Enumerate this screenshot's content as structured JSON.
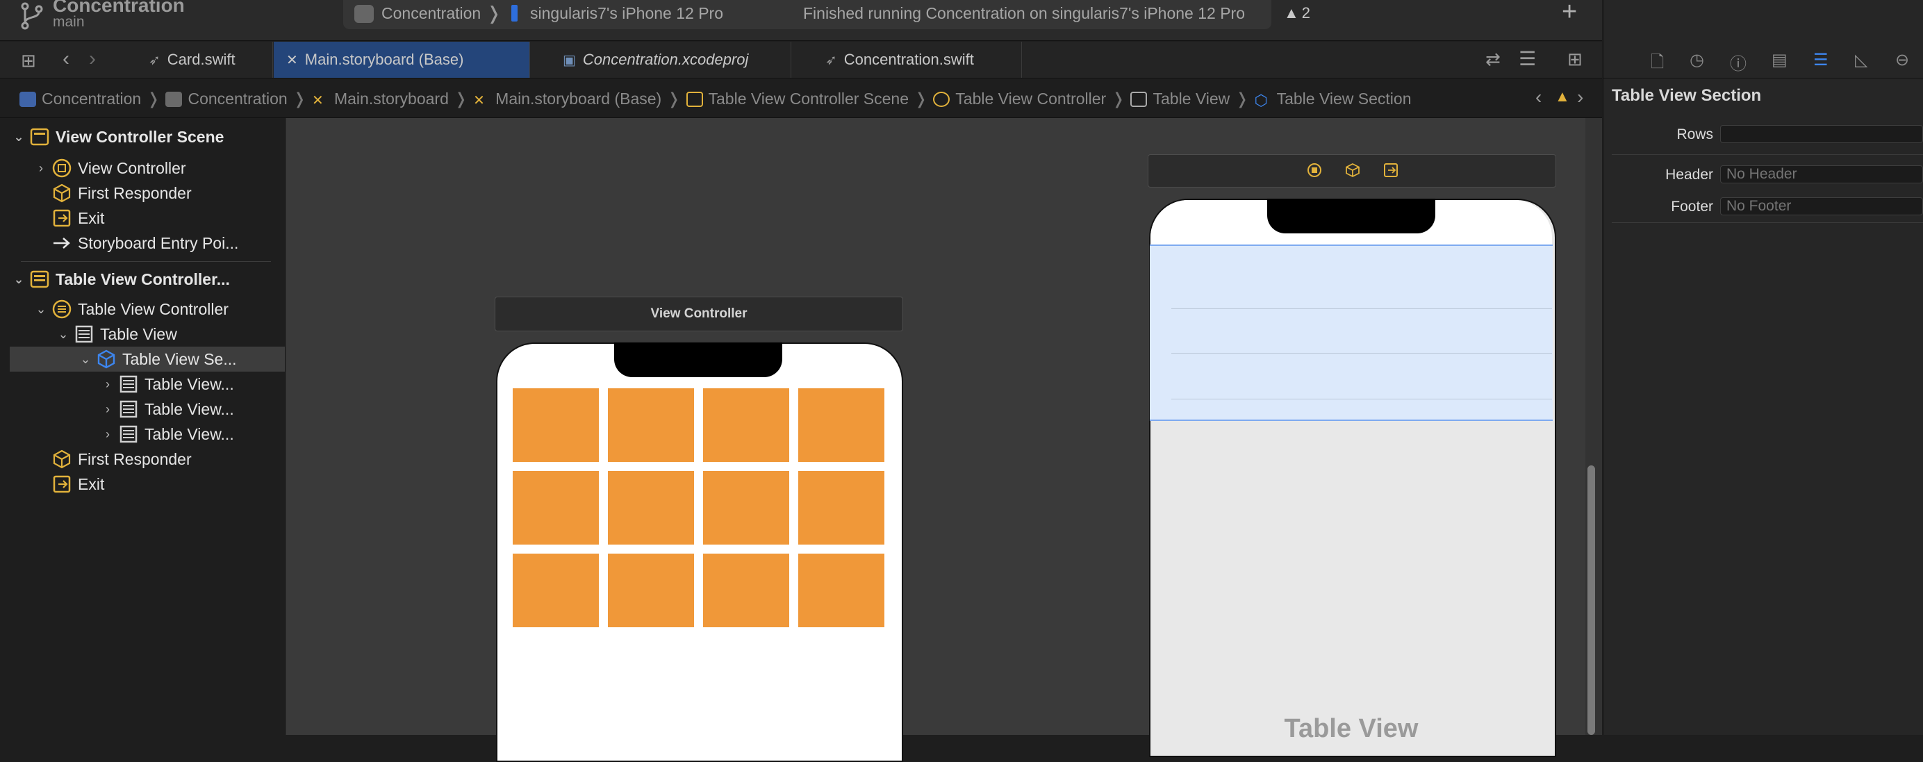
{
  "toolbar": {
    "project_name": "Concentration",
    "branch": "main",
    "scheme": "Concentration",
    "scheme_separator": "❭",
    "device": "singularis7's iPhone 12 Pro",
    "status": "Finished running Concentration on singularis7's iPhone 12 Pro",
    "warning_count": "2",
    "add_symbol": "+"
  },
  "tabs": [
    {
      "label": "Card.swift"
    },
    {
      "label": "Main.storyboard (Base)",
      "active": true
    },
    {
      "label": "Concentration.xcodeproj"
    },
    {
      "label": "Concentration.swift"
    }
  ],
  "breadcrumbs": [
    "Concentration",
    "Concentration",
    "Main.storyboard",
    "Main.storyboard (Base)",
    "Table View Controller Scene",
    "Table View Controller",
    "Table View",
    "Table View Section"
  ],
  "outline": [
    {
      "label": "View Controller Scene"
    },
    {
      "label": "View Controller"
    },
    {
      "label": "First Responder"
    },
    {
      "label": "Exit"
    },
    {
      "label": "Storyboard Entry Poi..."
    },
    {
      "label": "Table View Controller..."
    },
    {
      "label": "Table View Controller"
    },
    {
      "label": "Table View"
    },
    {
      "label": "Table View Se..."
    },
    {
      "label": "Table View..."
    },
    {
      "label": "Table View..."
    },
    {
      "label": "Table View..."
    },
    {
      "label": "First Responder"
    },
    {
      "label": "Exit"
    }
  ],
  "canvas": {
    "vc_title": "View Controller",
    "table_view_label": "Table View"
  },
  "inspector": {
    "title": "Table View Section",
    "rows_label": "Rows",
    "rows_value": "",
    "header_label": "Header",
    "header_placeholder": "No Header",
    "footer_label": "Footer",
    "footer_placeholder": "No Footer"
  },
  "colors": {
    "accent": "#2e6edc",
    "card": "#f09839",
    "selection": "#dce9fb",
    "warning": "#e2b23b"
  }
}
